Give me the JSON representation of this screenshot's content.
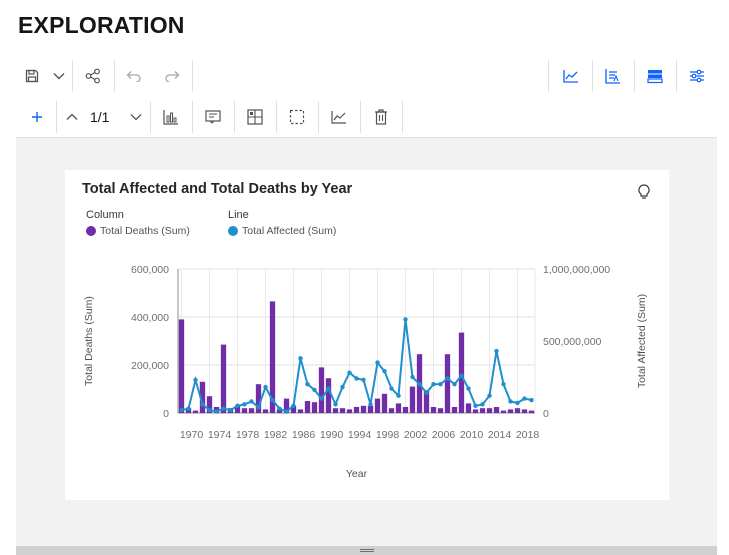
{
  "page": {
    "title": "EXPLORATION"
  },
  "toolbar": {
    "save_icon": "save-icon",
    "pagination": "1/1"
  },
  "chart_data": {
    "type": "bar",
    "title": "Total Affected and Total Deaths by Year",
    "xlabel": "Year",
    "ylabel": "Total Deaths (Sum)",
    "y2label": "Total Affected (Sum)",
    "legend": {
      "column_heading": "Column",
      "line_heading": "Line",
      "column_series": "Total Deaths (Sum)",
      "line_series": "Total Affected (Sum)"
    },
    "ylim": [
      0,
      600000
    ],
    "y2lim": [
      0,
      1000000000
    ],
    "y_ticks": [
      "0",
      "200,000",
      "400,000",
      "600,000"
    ],
    "y2_ticks": [
      "0",
      "500,000,000",
      "1,000,000,000"
    ],
    "x_ticks": [
      "1970",
      "1974",
      "1978",
      "1982",
      "1986",
      "1990",
      "1994",
      "1998",
      "2002",
      "2006",
      "2010",
      "2014",
      "2018"
    ],
    "x": [
      1970,
      1971,
      1972,
      1973,
      1974,
      1975,
      1976,
      1977,
      1978,
      1979,
      1980,
      1981,
      1982,
      1983,
      1984,
      1985,
      1986,
      1987,
      1988,
      1989,
      1990,
      1991,
      1992,
      1993,
      1994,
      1995,
      1996,
      1997,
      1998,
      1999,
      2000,
      2001,
      2002,
      2003,
      2004,
      2005,
      2006,
      2007,
      2008,
      2009,
      2010,
      2011,
      2012,
      2013,
      2014,
      2015,
      2016,
      2017,
      2018,
      2019,
      2020
    ],
    "series": [
      {
        "name": "Total Deaths (Sum)",
        "kind": "column",
        "color": "#6f2da8",
        "values": [
          390000,
          20000,
          10000,
          130000,
          70000,
          25000,
          285000,
          20000,
          30000,
          20000,
          20000,
          120000,
          15000,
          465000,
          15000,
          60000,
          30000,
          15000,
          50000,
          45000,
          190000,
          145000,
          20000,
          20000,
          15000,
          25000,
          30000,
          30000,
          60000,
          80000,
          20000,
          40000,
          25000,
          110000,
          245000,
          95000,
          25000,
          20000,
          245000,
          25000,
          335000,
          40000,
          15000,
          20000,
          20000,
          25000,
          10000,
          15000,
          20000,
          15000,
          10000
        ]
      },
      {
        "name": "Total Affected (Sum)",
        "kind": "line",
        "color": "#1f8fce",
        "values": [
          20000000,
          30000000,
          230000000,
          60000000,
          20000000,
          10000000,
          30000000,
          20000000,
          50000000,
          60000000,
          80000000,
          40000000,
          180000000,
          90000000,
          30000000,
          10000000,
          50000000,
          380000000,
          200000000,
          160000000,
          100000000,
          170000000,
          60000000,
          180000000,
          280000000,
          240000000,
          230000000,
          60000000,
          350000000,
          290000000,
          170000000,
          120000000,
          650000000,
          250000000,
          200000000,
          140000000,
          200000000,
          200000000,
          240000000,
          200000000,
          260000000,
          170000000,
          50000000,
          60000000,
          120000000,
          430000000,
          200000000,
          80000000,
          70000000,
          100000000,
          90000000
        ]
      }
    ],
    "grid": true,
    "legend_placement": "top-left"
  }
}
